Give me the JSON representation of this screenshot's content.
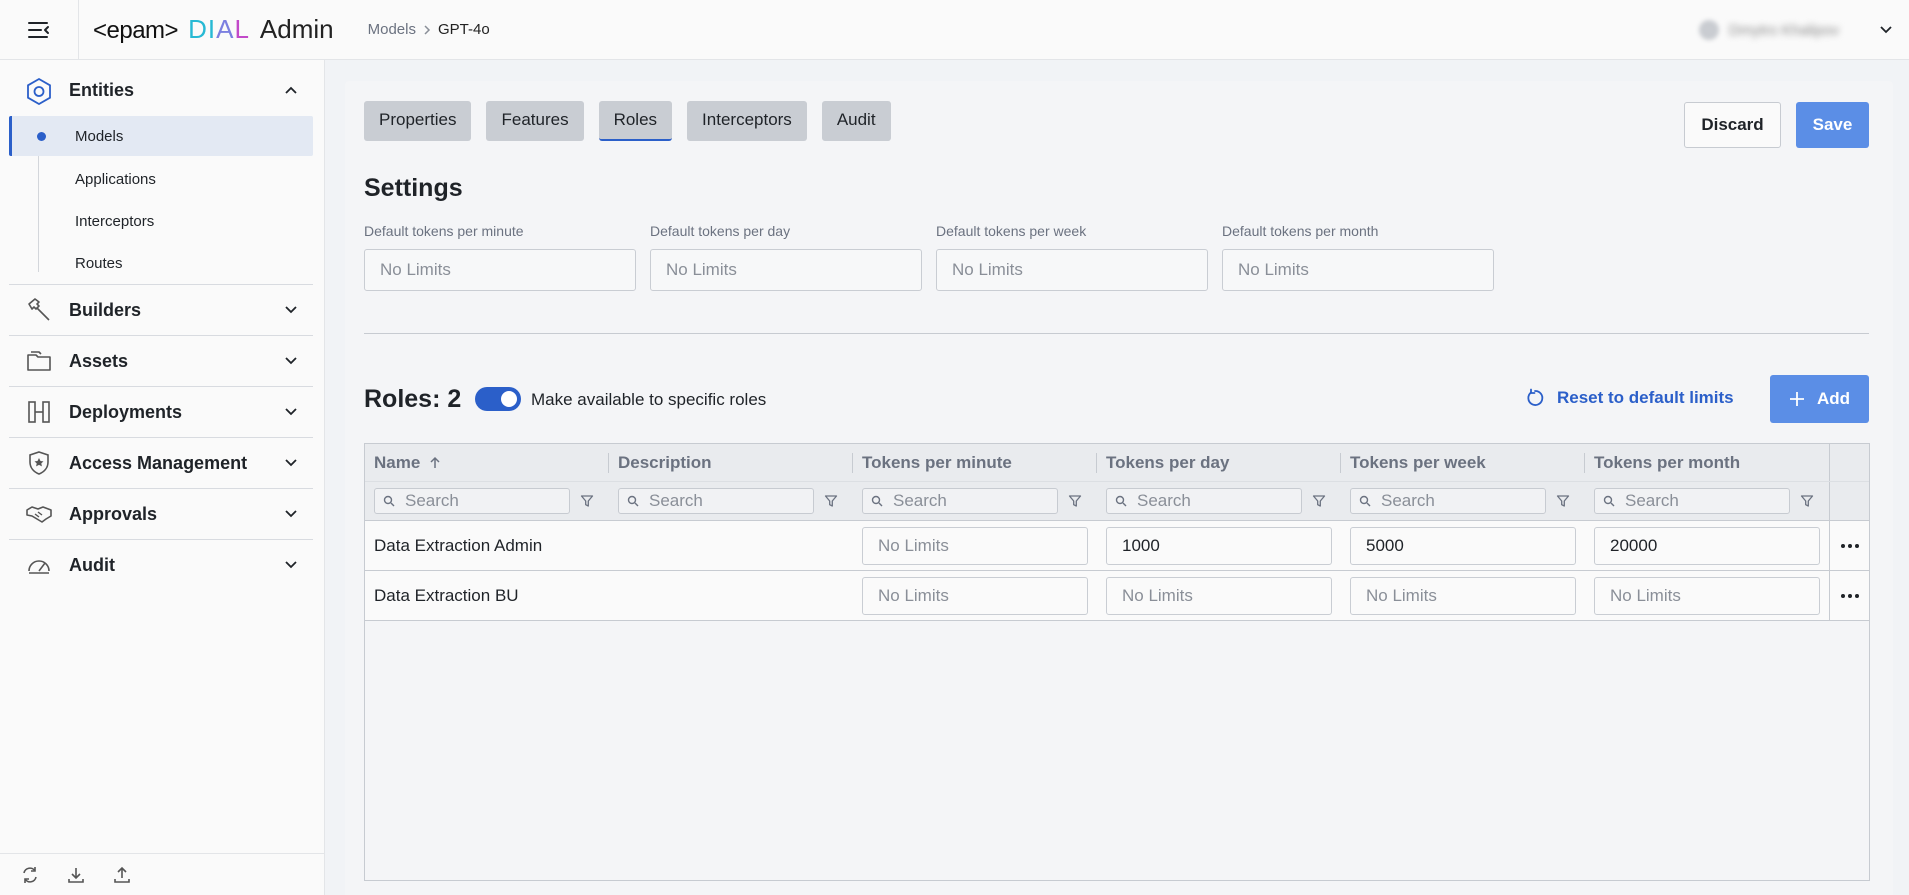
{
  "header": {
    "logo_epam": "<epam>",
    "logo_dial": [
      "D",
      "I",
      "A",
      "L"
    ],
    "logo_admin": "Admin",
    "breadcrumb": {
      "parent": "Models",
      "current": "GPT-4o"
    },
    "user_name": "Dmytro Khalipov"
  },
  "sidebar": {
    "entities_label": "Entities",
    "entities_items": [
      {
        "label": "Models",
        "active": true
      },
      {
        "label": "Applications"
      },
      {
        "label": "Interceptors"
      },
      {
        "label": "Routes"
      }
    ],
    "sections": [
      {
        "label": "Builders",
        "icon": "hammer-icon"
      },
      {
        "label": "Assets",
        "icon": "folder-icon"
      },
      {
        "label": "Deployments",
        "icon": "deployments-icon"
      },
      {
        "label": "Access Management",
        "icon": "shield-star-icon"
      },
      {
        "label": "Approvals",
        "icon": "handshake-icon"
      },
      {
        "label": "Audit",
        "icon": "gauge-icon"
      }
    ],
    "footer_icons": [
      "refresh-icon",
      "download-icon",
      "upload-icon"
    ]
  },
  "tabs": [
    {
      "label": "Properties"
    },
    {
      "label": "Features"
    },
    {
      "label": "Roles",
      "active": true
    },
    {
      "label": "Interceptors"
    },
    {
      "label": "Audit"
    }
  ],
  "actions": {
    "discard": "Discard",
    "save": "Save"
  },
  "settings": {
    "title": "Settings",
    "fields": [
      {
        "label": "Default tokens per minute",
        "placeholder": "No Limits"
      },
      {
        "label": "Default tokens per day",
        "placeholder": "No Limits"
      },
      {
        "label": "Default tokens per week",
        "placeholder": "No Limits"
      },
      {
        "label": "Default tokens per month",
        "placeholder": "No Limits"
      }
    ]
  },
  "roles": {
    "title": "Roles: 2",
    "toggle_on": true,
    "toggle_label": "Make available to specific roles",
    "reset_label": "Reset to default limits",
    "add_label": "Add",
    "columns": [
      "Name",
      "Description",
      "Tokens per minute",
      "Tokens per day",
      "Tokens per week",
      "Tokens per month"
    ],
    "search_placeholder": "Search",
    "rows": [
      {
        "name": "Data Extraction Admin",
        "description": "",
        "minute": "",
        "day": "1000",
        "week": "5000",
        "month": "20000"
      },
      {
        "name": "Data Extraction BU",
        "description": "",
        "minute": "",
        "day": "",
        "week": "",
        "month": ""
      }
    ],
    "empty_cell_placeholder": "No Limits"
  },
  "colors": {
    "accent": "#2b5fc9",
    "primary_button": "#5b8ee6"
  }
}
